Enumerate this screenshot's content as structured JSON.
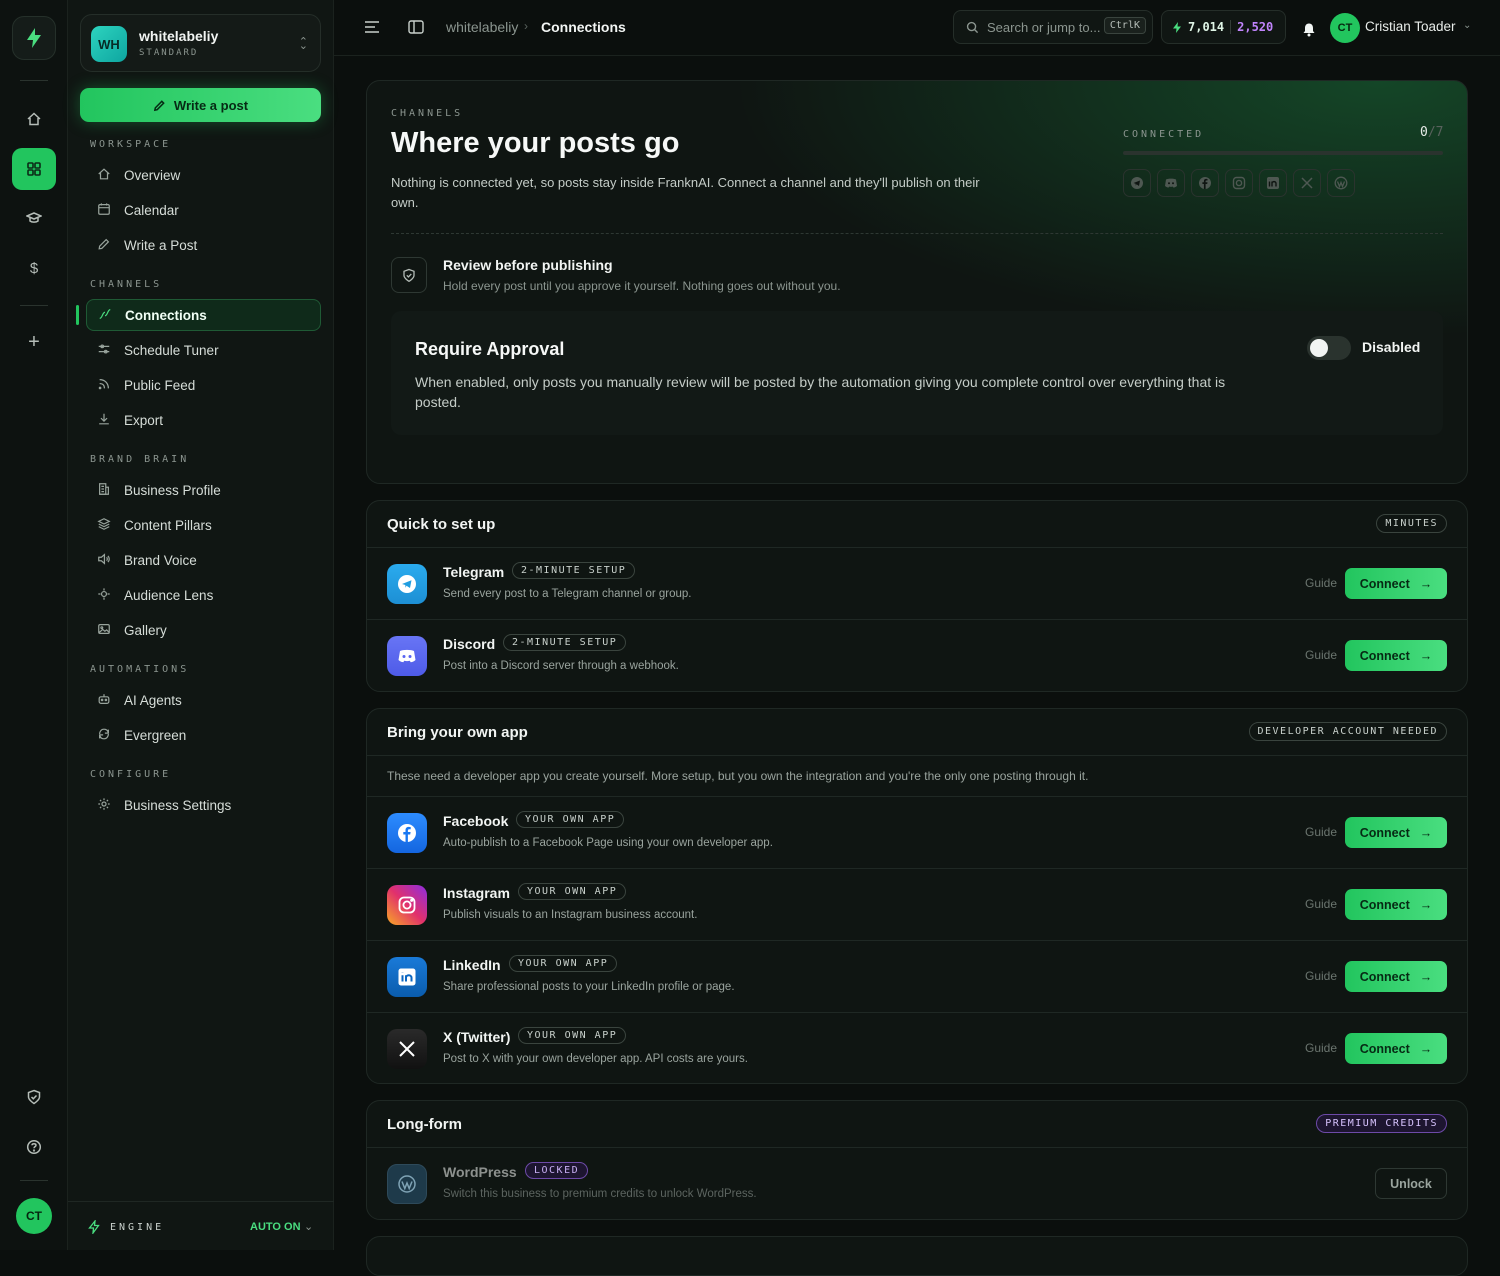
{
  "workspace": {
    "initials": "WH",
    "name": "whitelabeliy",
    "plan": "STANDARD"
  },
  "sidebar": {
    "write_button": "Write a post",
    "sections": [
      {
        "label": "WORKSPACE",
        "items": [
          {
            "label": "Overview",
            "icon": "home-icon"
          },
          {
            "label": "Calendar",
            "icon": "calendar-icon"
          },
          {
            "label": "Write a Post",
            "icon": "pencil-icon"
          }
        ]
      },
      {
        "label": "CHANNELS",
        "items": [
          {
            "label": "Connections",
            "icon": "link-icon",
            "active": true
          },
          {
            "label": "Schedule Tuner",
            "icon": "sliders-icon"
          },
          {
            "label": "Public Feed",
            "icon": "rss-icon"
          },
          {
            "label": "Export",
            "icon": "download-icon"
          }
        ]
      },
      {
        "label": "BRAND BRAIN",
        "items": [
          {
            "label": "Business Profile",
            "icon": "building-icon"
          },
          {
            "label": "Content Pillars",
            "icon": "layers-icon"
          },
          {
            "label": "Brand Voice",
            "icon": "speaker-icon"
          },
          {
            "label": "Audience Lens",
            "icon": "crosshair-icon"
          },
          {
            "label": "Gallery",
            "icon": "image-icon"
          }
        ]
      },
      {
        "label": "AUTOMATIONS",
        "items": [
          {
            "label": "AI Agents",
            "icon": "robot-icon"
          },
          {
            "label": "Evergreen",
            "icon": "refresh-icon"
          }
        ]
      },
      {
        "label": "CONFIGURE",
        "items": [
          {
            "label": "Business Settings",
            "icon": "gear-icon"
          }
        ]
      }
    ],
    "engine": {
      "label": "ENGINE",
      "value": "AUTO ON"
    }
  },
  "rail": {
    "avatar": "CT"
  },
  "topbar": {
    "breadcrumb": [
      "whitelabeliy",
      "Connections"
    ],
    "search_placeholder": "Search or jump to...",
    "search_kbd": "CtrlK",
    "credits_a": "7,014",
    "credits_b": "2,520",
    "user_initials": "CT",
    "user_name": "Cristian Toader"
  },
  "hero": {
    "eyebrow": "CHANNELS",
    "title": "Where your posts go",
    "desc": "Nothing is connected yet, so posts stay inside FranknAI. Connect a channel and they'll publish on their own.",
    "connected_label": "CONNECTED",
    "connected_count": "0",
    "connected_total": "/7",
    "connected_fraction": 0,
    "review_title": "Review before publishing",
    "review_desc": "Hold every post until you approve it yourself. Nothing goes out without you.",
    "approval_title": "Require Approval",
    "approval_desc": "When enabled, only posts you manually review will be posted by the automation giving you complete control over everything that is posted.",
    "toggle_label": "Disabled",
    "toggle_on": false
  },
  "quick": {
    "title": "Quick to set up",
    "pill": "MINUTES",
    "apps": [
      {
        "name": "Telegram",
        "tag": "2-MINUTE SETUP",
        "desc": "Send every post to a Telegram channel or group.",
        "icon": "telegram-icon",
        "color": "#1f9de0"
      },
      {
        "name": "Discord",
        "tag": "2-MINUTE SETUP",
        "desc": "Post into a Discord server through a webhook.",
        "icon": "discord-icon",
        "color": "#5865f2"
      }
    ]
  },
  "byo": {
    "title": "Bring your own app",
    "pill": "DEVELOPER ACCOUNT NEEDED",
    "note": "These need a developer app you create yourself. More setup, but you own the integration and you're the only one posting through it.",
    "apps": [
      {
        "name": "Facebook",
        "tag": "YOUR OWN APP",
        "desc": "Auto-publish to a Facebook Page using your own developer app.",
        "icon": "facebook-icon",
        "color": "#1877f2"
      },
      {
        "name": "Instagram",
        "tag": "YOUR OWN APP",
        "desc": "Publish visuals to an Instagram business account.",
        "icon": "instagram-icon",
        "color": "#e1306c"
      },
      {
        "name": "LinkedIn",
        "tag": "YOUR OWN APP",
        "desc": "Share professional posts to your LinkedIn profile or page.",
        "icon": "linkedin-icon",
        "color": "#0a66c2"
      },
      {
        "name": "X (Twitter)",
        "tag": "YOUR OWN APP",
        "desc": "Post to X with your own developer app. API costs are yours.",
        "icon": "x-icon",
        "color": "#1a1a1a"
      }
    ]
  },
  "longform": {
    "title": "Long-form",
    "pill": "PREMIUM CREDITS",
    "apps": [
      {
        "name": "WordPress",
        "tag": "LOCKED",
        "desc": "Switch this business to premium credits to unlock WordPress.",
        "icon": "wordpress-icon",
        "color": "#1e3a4a"
      }
    ],
    "unlock_label": "Unlock"
  },
  "labels": {
    "guide": "Guide",
    "connect": "Connect"
  }
}
